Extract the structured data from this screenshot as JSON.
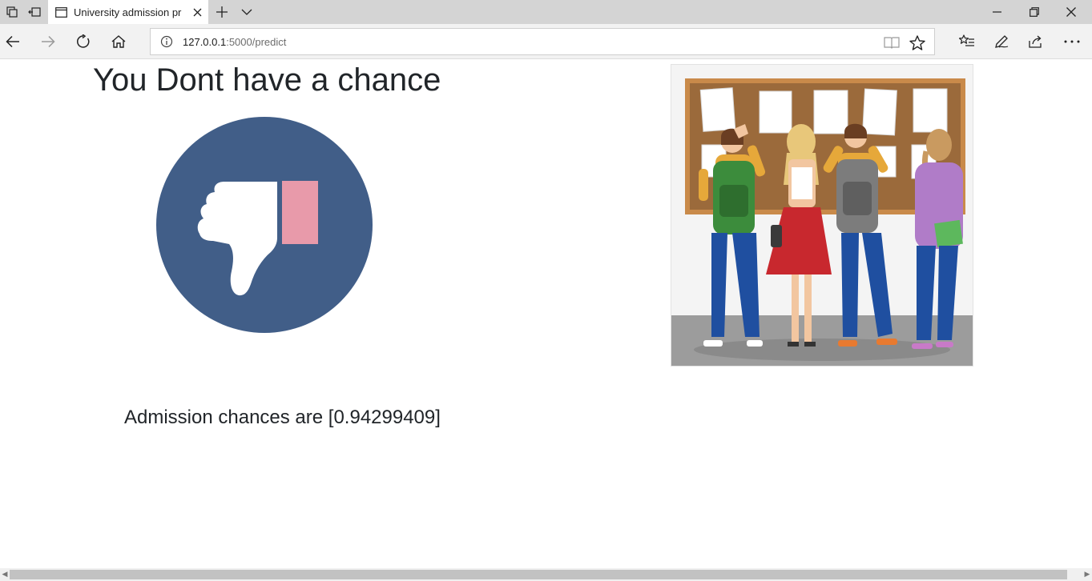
{
  "browser": {
    "tab": {
      "title": "University admission pr",
      "icon": "page-icon"
    },
    "new_tab_icon": "plus-icon",
    "tab_list_icon": "chevron-down-icon",
    "window": {
      "minimize": "minimize-icon",
      "restore": "restore-icon",
      "close": "close-icon"
    },
    "address": {
      "host": "127.0.0.1",
      "path": ":5000/predict"
    }
  },
  "page": {
    "heading": "You Dont have a chance",
    "result_text": "Admission chances are [0.94299409]",
    "thumb_icon": "thumbs-down-icon",
    "illustration": "students-notice-board-illustration"
  },
  "colors": {
    "thumb_circle": "#415e88",
    "thumb_cuff": "#e89aaa",
    "chrome_bg": "#d4d4d4",
    "nav_bg": "#f2f2f2"
  }
}
